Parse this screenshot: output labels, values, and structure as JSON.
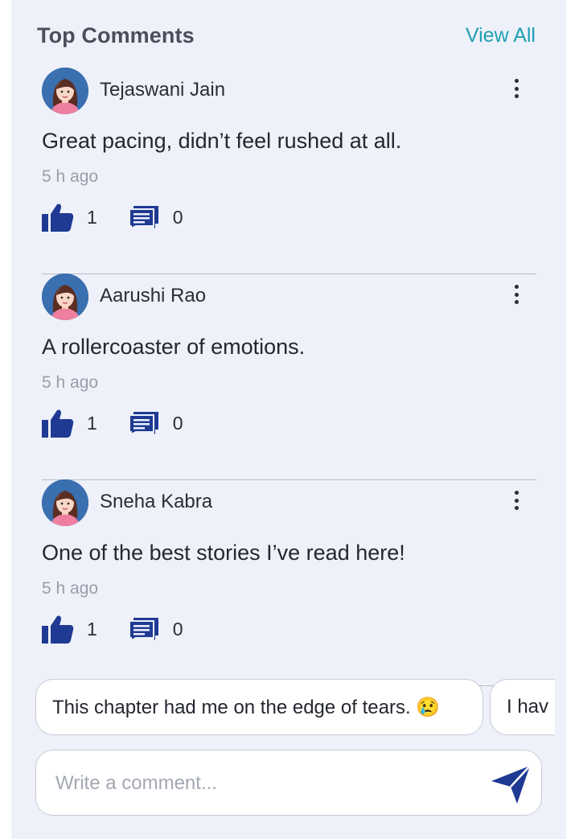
{
  "header": {
    "title": "Top Comments",
    "view_all": "View All"
  },
  "colors": {
    "accent": "#1fa0b3",
    "icon_blue": "#1f3a93",
    "panel_bg": "#eef1f9"
  },
  "comments": [
    {
      "user": "Tejaswani Jain",
      "text": "Great pacing, didn’t feel rushed at all.",
      "time": "5 h ago",
      "likes": "1",
      "replies": "0"
    },
    {
      "user": "Aarushi Rao",
      "text": "A rollercoaster of emotions.",
      "time": "5 h ago",
      "likes": "1",
      "replies": "0"
    },
    {
      "user": "Sneha Kabra",
      "text": "One of the best stories I’ve read here!",
      "time": "5 h ago",
      "likes": "1",
      "replies": "0"
    }
  ],
  "suggestions": [
    {
      "text": "This chapter had me on the edge of tears. 😢"
    },
    {
      "text": "I hav"
    }
  ],
  "composer": {
    "placeholder": "Write a comment..."
  },
  "icons": {
    "like": "thumbs-up-icon",
    "reply": "comments-icon",
    "more": "more-vertical-icon",
    "send": "send-icon"
  }
}
